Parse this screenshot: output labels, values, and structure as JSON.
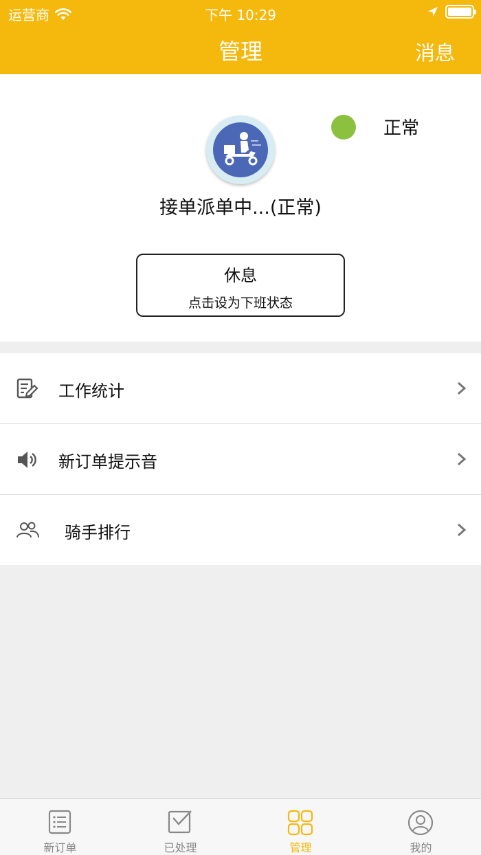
{
  "status_bar": {
    "carrier": "运营商",
    "time": "下午 10:29"
  },
  "nav": {
    "title": "管理",
    "right_action": "消息"
  },
  "profile": {
    "status_indicator_color": "#8cc13f",
    "status_label": "正常",
    "main_status": "接单派单中...(正常)",
    "rest_button": {
      "title": "休息",
      "subtitle": "点击设为下班状态"
    }
  },
  "menu": {
    "items": [
      {
        "label": "工作统计",
        "icon": "edit-note-icon"
      },
      {
        "label": "新订单提示音",
        "icon": "speaker-icon"
      },
      {
        "label": "骑手排行",
        "icon": "users-icon"
      }
    ]
  },
  "tabbar": {
    "active_color": "#f5b80c",
    "tabs": [
      {
        "label": "新订单",
        "icon": "list-icon"
      },
      {
        "label": "已处理",
        "icon": "checkbox-icon"
      },
      {
        "label": "管理",
        "icon": "grid-icon",
        "active": true
      },
      {
        "label": "我的",
        "icon": "user-icon"
      }
    ]
  },
  "colors": {
    "brand": "#f5b80c",
    "avatar_bg": "#4b68b6"
  }
}
